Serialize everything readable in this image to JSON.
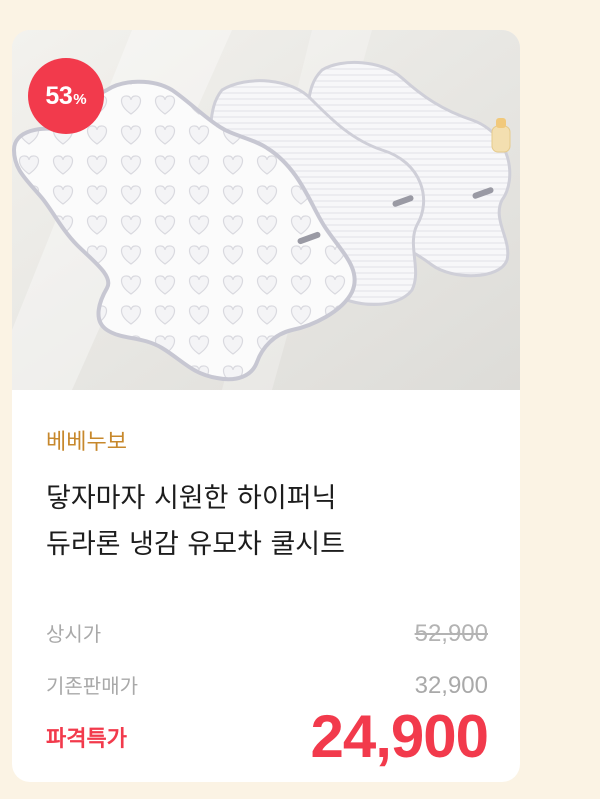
{
  "badge": {
    "discount_number": "53",
    "discount_unit": "%",
    "color": "#f23a4c"
  },
  "product": {
    "brand": "베베누보",
    "title_line1": "닿자마자 시원한 하이퍼닉",
    "title_line2": "듀라론 냉감 유모차 쿨시트"
  },
  "pricing": {
    "list_label": "상시가",
    "list_price": "52,900",
    "previous_label": "기존판매가",
    "previous_price": "32,900",
    "sale_label": "파격특가",
    "sale_price": "24,900"
  },
  "colors": {
    "page_background": "#fbf3e4",
    "brand_text": "#c7882c",
    "accent": "#f23a4c"
  },
  "image": {
    "icon": "quilted-stroller-seat-liner-photo"
  }
}
